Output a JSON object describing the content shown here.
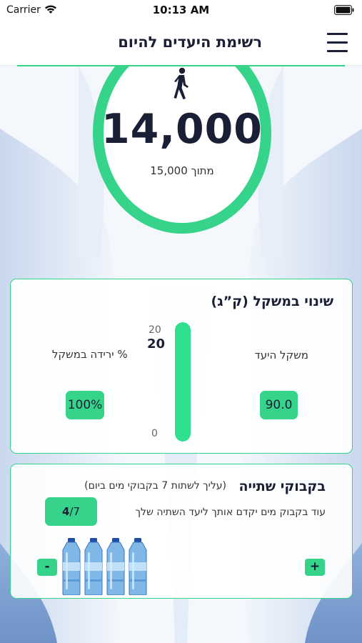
{
  "status_bar": {
    "carrier": "Carrier",
    "time": "10:13 AM",
    "icons": [
      "wifi-icon",
      "battery-icon"
    ]
  },
  "header": {
    "title": "רשימת היעדים להיום",
    "menu_icon": "hamburger-menu-icon"
  },
  "steps": {
    "icon": "walking-person-icon",
    "value": "14,000",
    "goal_text": "מתוך 15,000"
  },
  "weight": {
    "title": "שינוי במשקל (ק”ג)",
    "lost_label": "% ירידה במשקל",
    "lost_value": "100%",
    "goal_label": "משקל היעד",
    "goal_value": "90.0",
    "scale_max": "20",
    "scale_current": "20",
    "scale_min": "0",
    "progress_fraction": 1.0
  },
  "water": {
    "title": "בקבוקי שתייה",
    "hint": "(עליך לשתות 7 בקבוקי מים ביום)",
    "subtitle": "עוד בקבוק מים יקדם אותך ליעד השתיה שלך",
    "counter_current": "4",
    "counter_total": "/7",
    "minus_label": "-",
    "plus_label": "+",
    "bottles_filled": 4,
    "bottle_icon": "water-bottle-icon"
  },
  "colors": {
    "accent": "#35d48a",
    "text": "#1a1f36",
    "background_art": "#dbe6f3"
  }
}
